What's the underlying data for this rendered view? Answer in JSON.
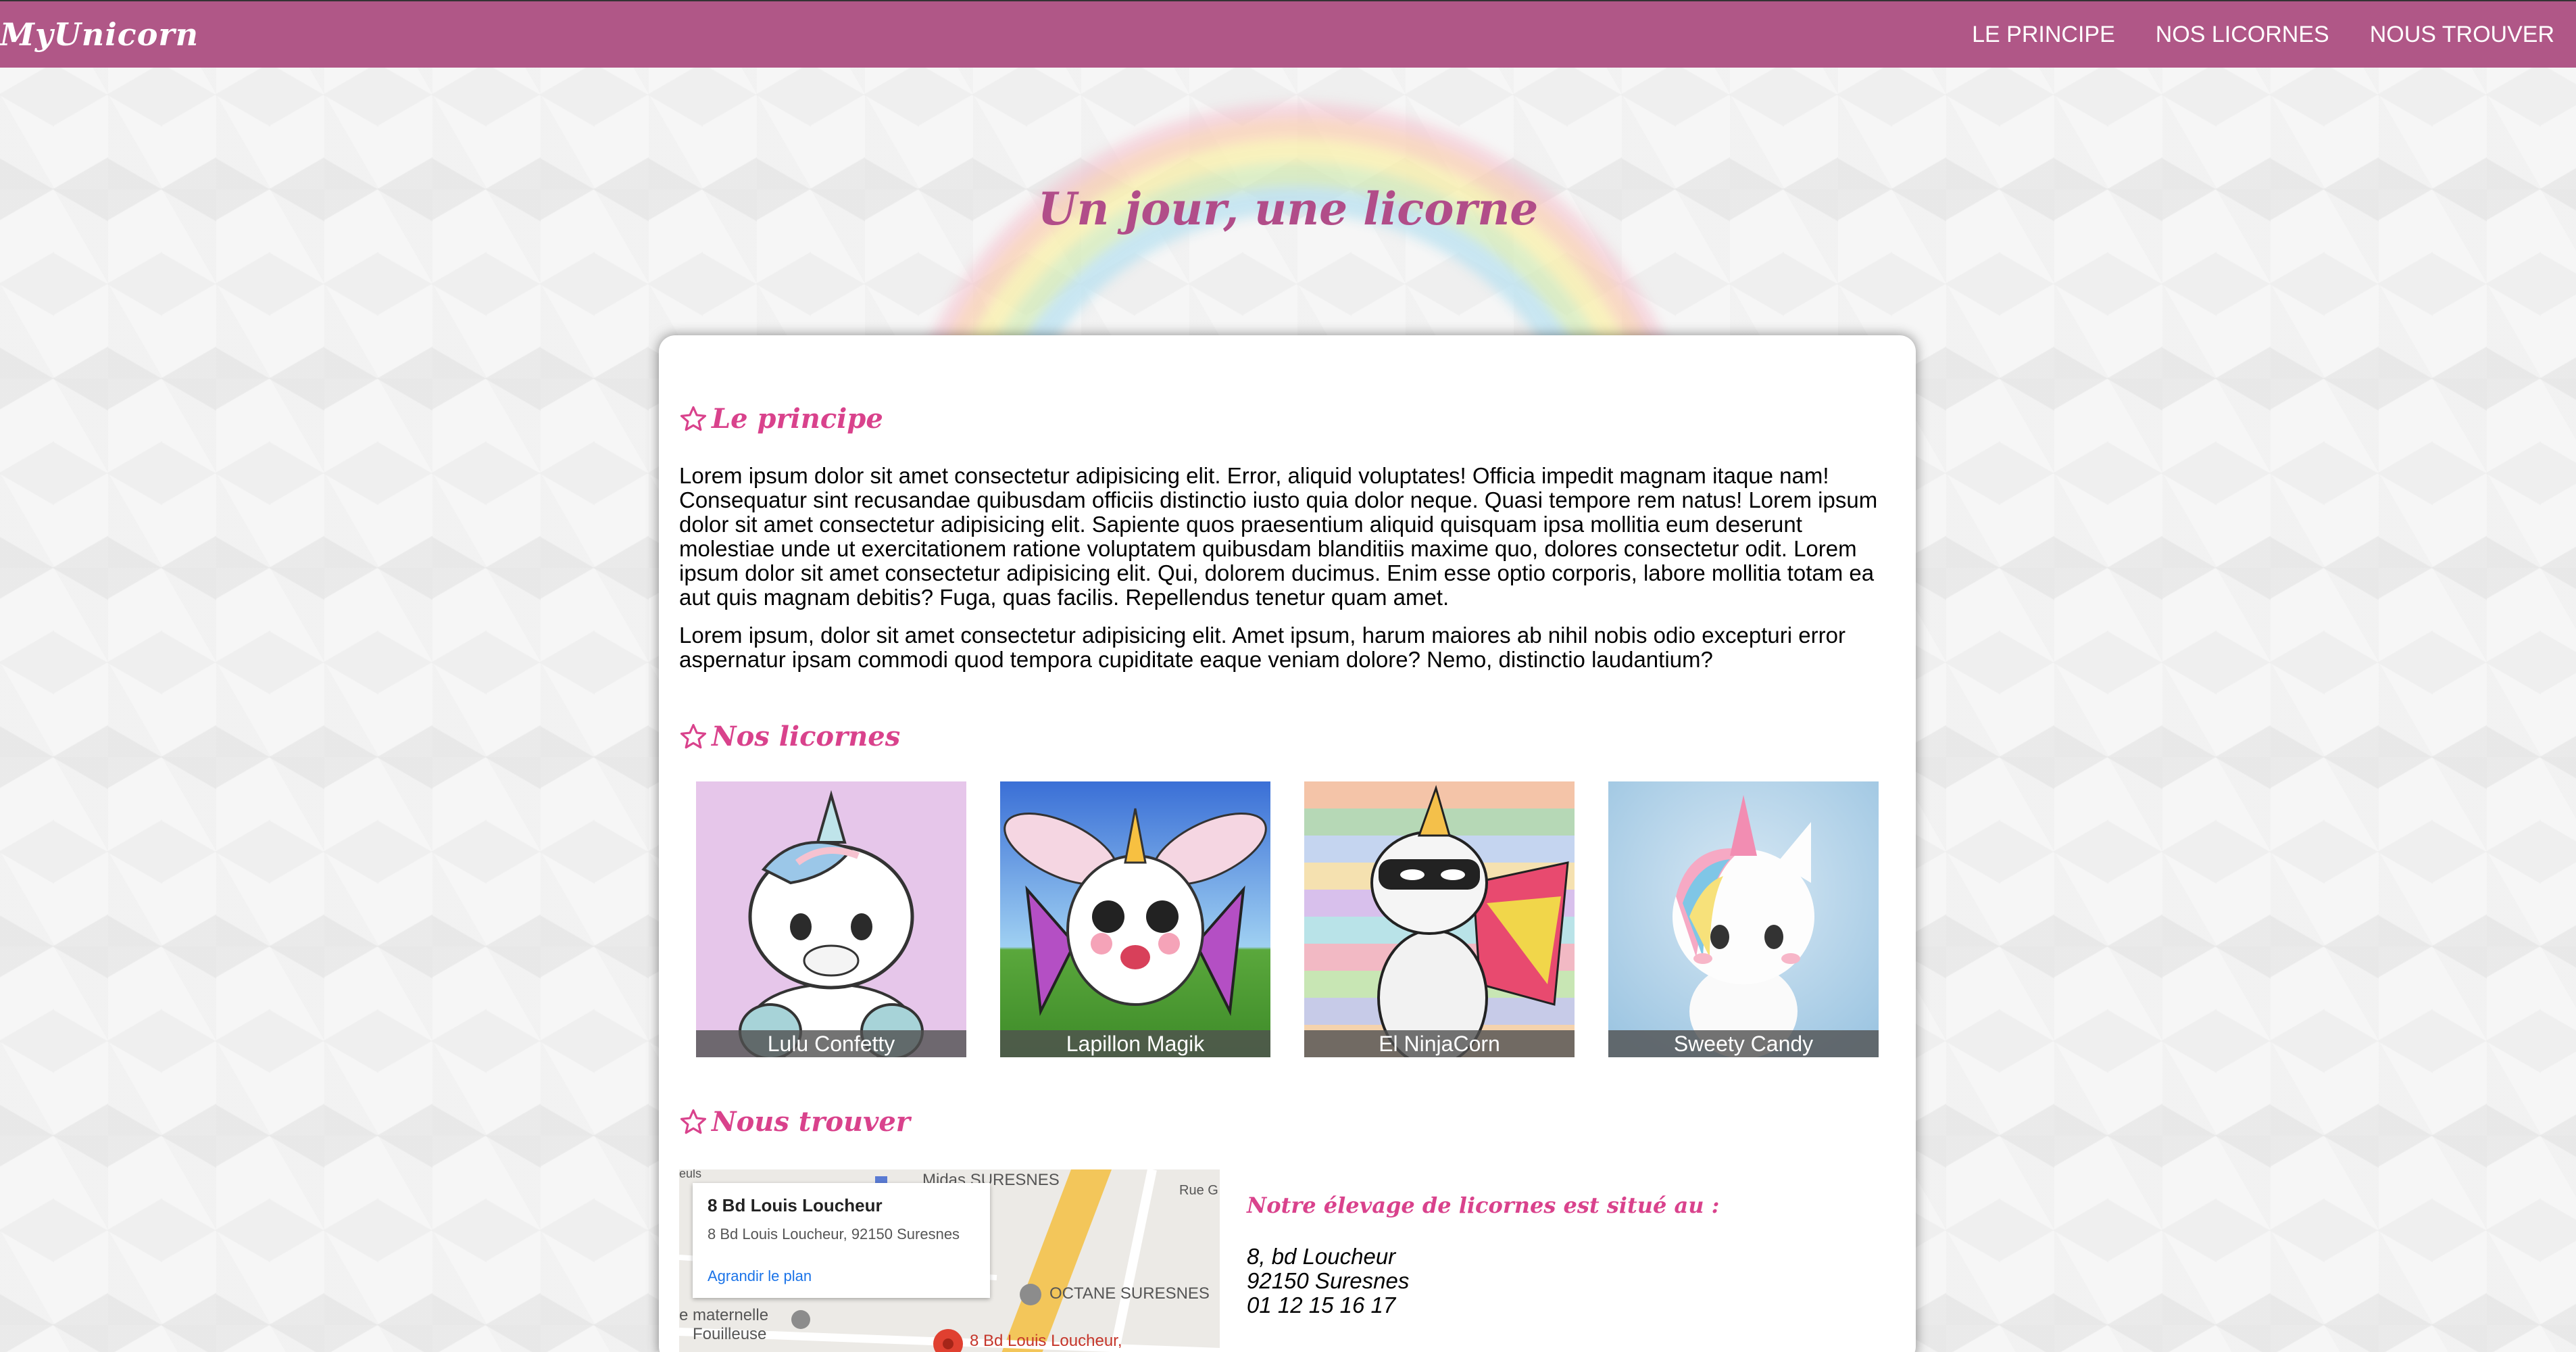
{
  "header": {
    "logo": "MyUnicorn",
    "nav": [
      "LE PRINCIPE",
      "NOS LICORNES",
      "NOUS TROUVER"
    ]
  },
  "hero": {
    "title": "Un jour, une licorne"
  },
  "principe": {
    "title": "Le principe",
    "paragraphs": [
      "Lorem ipsum dolor sit amet consectetur adipisicing elit. Error, aliquid voluptates! Officia impedit magnam itaque nam! Consequatur sint recusandae quibusdam officiis distinctio iusto quia dolor neque. Quasi tempore rem natus! Lorem ipsum dolor sit amet consectetur adipisicing elit. Sapiente quos praesentium aliquid quisquam ipsa mollitia eum deserunt molestiae unde ut exercitationem ratione voluptatem quibusdam blanditiis maxime quo, dolores consectetur odit. Lorem ipsum dolor sit amet consectetur adipisicing elit. Qui, dolorem ducimus. Enim esse optio corporis, labore mollitia totam ea aut quis magnam debitis? Fuga, quas facilis. Repellendus tenetur quam amet.",
      "Lorem ipsum, dolor sit amet consectetur adipisicing elit. Amet ipsum, harum maiores ab nihil nobis odio excepturi error aspernatur ipsam commodi quod tempora cupiditate eaque veniam dolore? Nemo, distinctio laudantium?"
    ]
  },
  "licornes": {
    "title": "Nos licornes",
    "items": [
      {
        "name": "Lulu Confetty"
      },
      {
        "name": "Lapillon Magik"
      },
      {
        "name": "El NinjaCorn"
      },
      {
        "name": "Sweety Candy"
      }
    ]
  },
  "trouver": {
    "title": "Nous trouver",
    "map": {
      "popup_title": "8 Bd Louis Loucheur",
      "popup_address": "8 Bd Louis Loucheur, 92150 Suresnes",
      "popup_link": "Agrandir le plan",
      "labels": [
        "Midas SURESNES",
        "OCTANE SURESNES",
        "Rue G",
        "8 Bd Louis Loucheur,",
        "e maternelle",
        "Fouilleuse",
        "euls"
      ]
    },
    "address_title": "Notre élevage de licornes est situé au :",
    "address_lines": [
      "8, bd Loucheur",
      "92150 Suresnes",
      "01 12 15 16 17"
    ]
  }
}
